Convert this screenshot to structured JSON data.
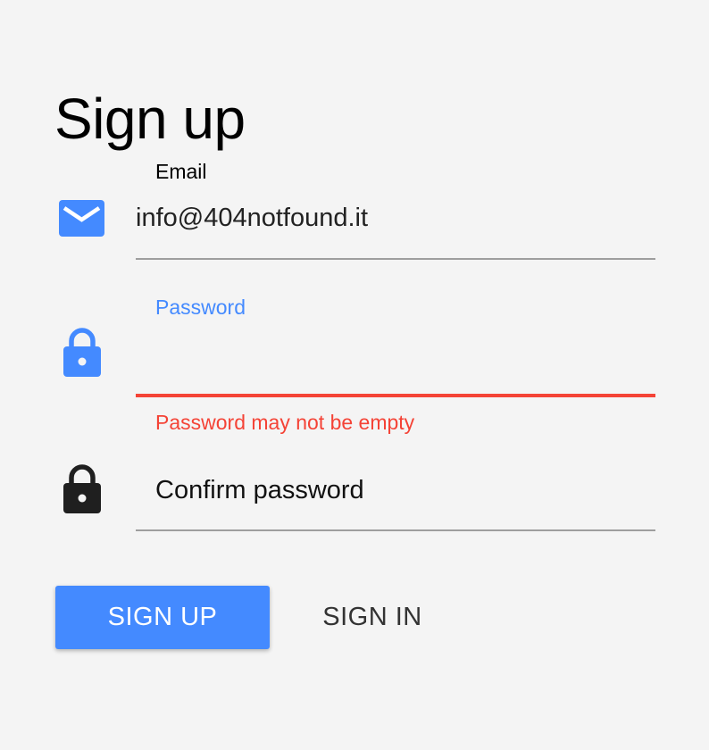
{
  "page": {
    "title": "Sign up"
  },
  "colors": {
    "accent": "#448aff",
    "error": "#f44336",
    "background": "#f4f4f4",
    "inactive_icon": "#1f1f1f"
  },
  "email": {
    "label": "Email",
    "value": "info@404notfound.it",
    "icon": "mail-icon"
  },
  "password": {
    "label": "Password",
    "value": "",
    "error": "Password may not be empty",
    "icon": "lock-icon"
  },
  "confirm_password": {
    "placeholder": "Confirm password",
    "value": "",
    "icon": "lock-icon"
  },
  "actions": {
    "sign_up_label": "SIGN UP",
    "sign_in_label": "SIGN IN"
  }
}
